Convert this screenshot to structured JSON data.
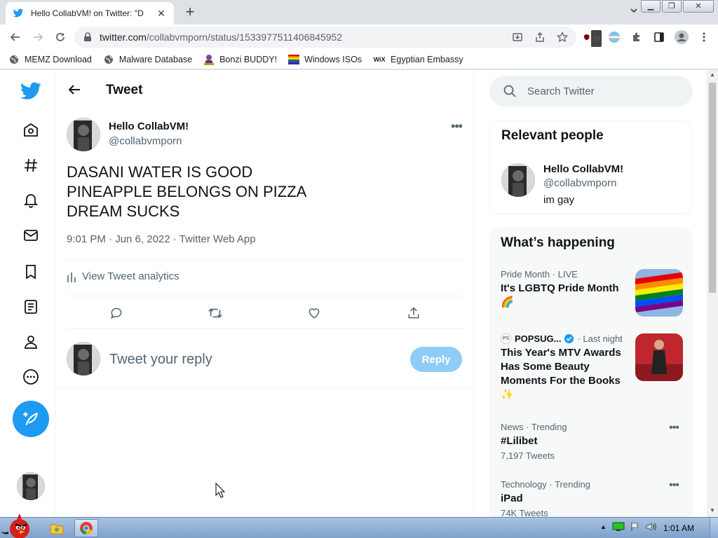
{
  "browser": {
    "tab_title": "Hello CollabVM! on Twitter: \"D",
    "url_host": "twitter.com",
    "url_path": "/collabvmporn/status/1533977511406845952",
    "extension_badge": "20"
  },
  "bookmarks": [
    {
      "label": "MEMZ Download",
      "icon": "globe-icon"
    },
    {
      "label": "Malware Database",
      "icon": "globe-icon"
    },
    {
      "label": "Bonzi BUDDY!",
      "icon": "bonzi-icon"
    },
    {
      "label": "Windows ISOs",
      "icon": "windows-flag-icon"
    },
    {
      "label": "Egyptian Embassy",
      "icon": "wix-icon"
    }
  ],
  "header": {
    "title": "Tweet"
  },
  "tweet": {
    "author_name": "Hello CollabVM!",
    "author_handle": "@collabvmporn",
    "lines": [
      "DASANI WATER IS GOOD",
      "PINEAPPLE BELONGS ON PIZZA",
      "DREAM SUCKS"
    ],
    "time": "9:01 PM · Jun 6, 2022 · Twitter Web App",
    "analytics_label": "View Tweet analytics"
  },
  "reply": {
    "placeholder": "Tweet your reply",
    "button_label": "Reply"
  },
  "search": {
    "placeholder": "Search Twitter"
  },
  "relevant_people": {
    "title": "Relevant people",
    "name": "Hello CollabVM!",
    "handle": "@collabvmporn",
    "bio": "im gay"
  },
  "whats_happening": {
    "title": "What’s happening",
    "trends": [
      {
        "meta": "Pride Month · LIVE",
        "headline": "It's LGBTQ Pride Month 🌈",
        "count": ""
      },
      {
        "meta_source": "POPSUG...",
        "meta_time": "· Last night",
        "headline": "This Year's MTV Awards Has Some Beauty Moments For the Books ✨",
        "count": ""
      },
      {
        "meta": "News · Trending",
        "headline": "#Lilibet",
        "count": "7,197 Tweets"
      },
      {
        "meta": "Technology · Trending",
        "headline": "iPad",
        "count": "74K Tweets"
      }
    ]
  },
  "taskbar": {
    "clock": "1:01 AM"
  },
  "colors": {
    "twitter_blue": "#1d9bf0",
    "reply_disabled": "#8ecdf8",
    "text_secondary": "#536471"
  }
}
